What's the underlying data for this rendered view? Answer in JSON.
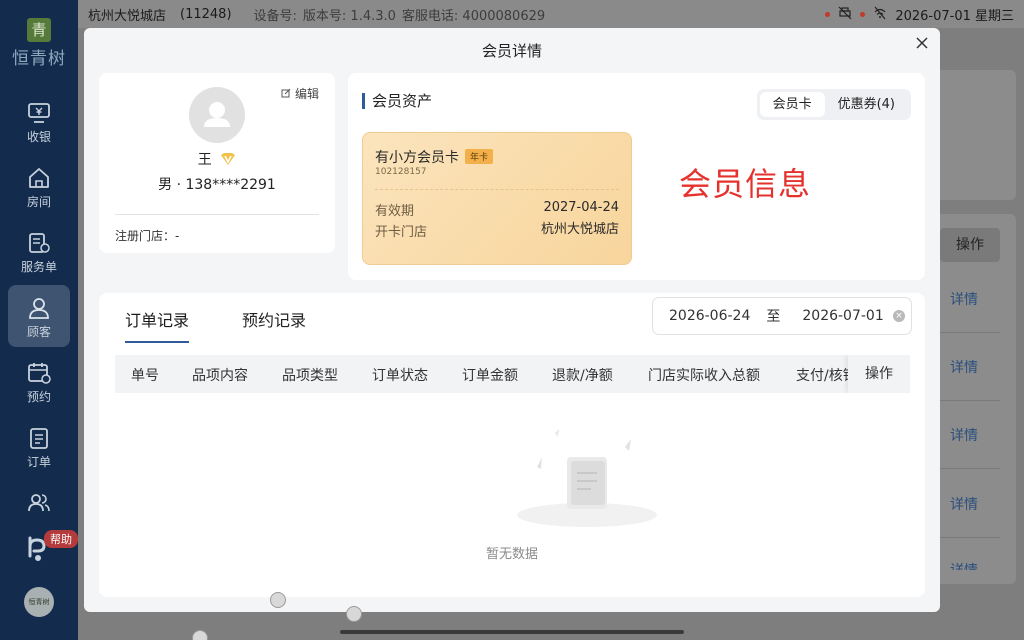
{
  "status_bar": {
    "store_name": "杭州大悦城店",
    "store_code": "(11248)",
    "device_label": "设备号:",
    "version_label": "版本号: 1.4.3.0",
    "hotline_label": "客服电话: 4000080629",
    "datetime": "2026-07-01 星期三"
  },
  "sidebar": {
    "logo_mark": "青",
    "logo_text": "恒青树",
    "items": [
      {
        "label": "收银",
        "icon": "cashier-icon"
      },
      {
        "label": "房间",
        "icon": "home-icon"
      },
      {
        "label": "服务单",
        "icon": "service-order-icon"
      },
      {
        "label": "顾客",
        "icon": "customer-icon"
      },
      {
        "label": "预约",
        "icon": "calendar-icon"
      },
      {
        "label": "订单",
        "icon": "order-icon"
      },
      {
        "label": "",
        "icon": "team-icon"
      }
    ],
    "help_badge": "帮助",
    "bottom_logo": "恒青树"
  },
  "background": {
    "op_header": "操作",
    "links": [
      "详情",
      "详情",
      "详情",
      "详情",
      "详情"
    ]
  },
  "modal": {
    "title": "会员详情",
    "profile": {
      "edit_label": "编辑",
      "name": "王",
      "gender_phone": "男 · 138****2291",
      "store_label": "注册门店：-"
    },
    "assets": {
      "title": "会员资产",
      "tabs": [
        "会员卡",
        "优惠券(4)"
      ],
      "active_tab": 0,
      "card": {
        "name": "有小方会员卡",
        "tag": "年卡",
        "number": "102128157",
        "validity_label": "有效期",
        "validity_value": "2027-04-24",
        "store_label": "开卡门店",
        "store_value": "杭州大悦城店"
      },
      "annotation": "会员信息"
    },
    "orders": {
      "tabs": [
        "订单记录",
        "预约记录"
      ],
      "active_tab": 0,
      "date_from": "2026-06-24",
      "date_sep": "至",
      "date_to": "2026-07-01",
      "columns": [
        "单号",
        "品项内容",
        "品项类型",
        "订单状态",
        "订单金额",
        "退款/净额",
        "门店实际收入总额",
        "支付/核销"
      ],
      "op_column": "操作",
      "empty_text": "暂无数据"
    }
  },
  "colors": {
    "sidebar_bg": "#132c4d",
    "accent": "#2f5a9c",
    "annotation": "#e5322d",
    "card_gold": "#f8d59c"
  }
}
